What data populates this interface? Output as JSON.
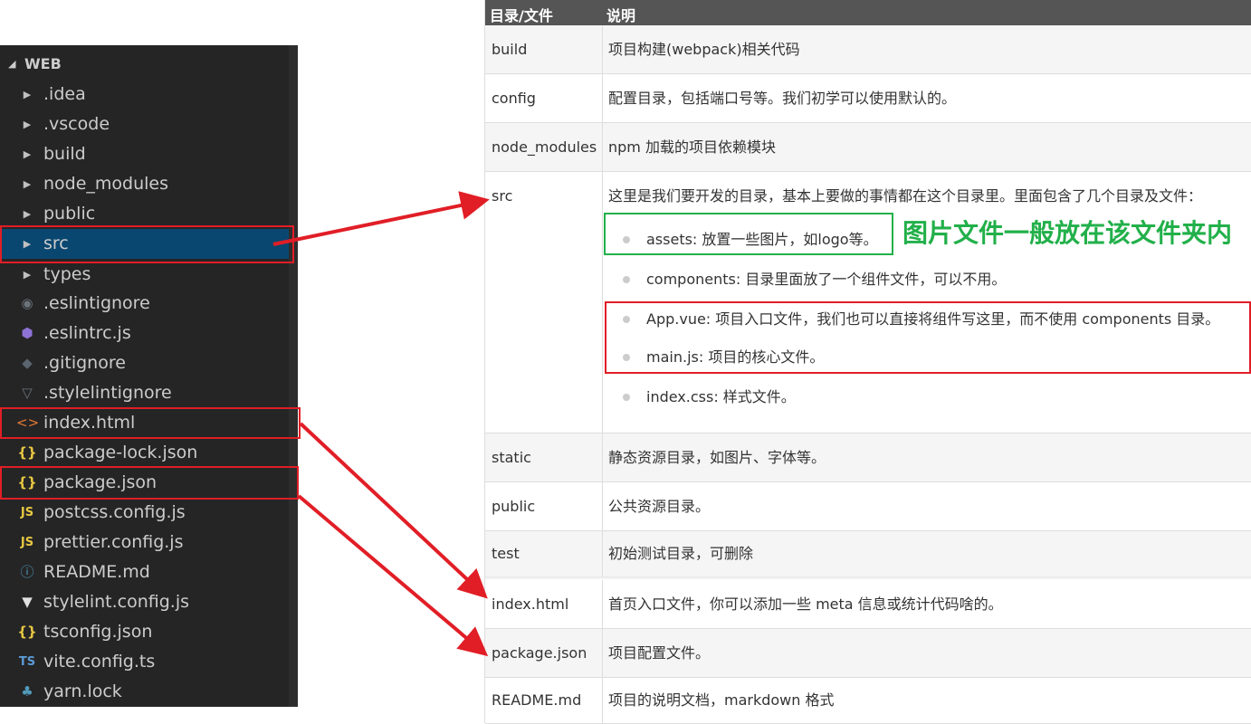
{
  "explorer": {
    "root_label": "WEB",
    "items": [
      {
        "label": ".idea",
        "kind": "folder",
        "icon": "chevron-right-icon"
      },
      {
        "label": ".vscode",
        "kind": "folder",
        "icon": "chevron-right-icon"
      },
      {
        "label": "build",
        "kind": "folder",
        "icon": "chevron-right-icon"
      },
      {
        "label": "node_modules",
        "kind": "folder",
        "icon": "chevron-right-icon"
      },
      {
        "label": "public",
        "kind": "folder",
        "icon": "chevron-right-icon"
      },
      {
        "label": "src",
        "kind": "folder",
        "icon": "chevron-right-icon",
        "selected": true
      },
      {
        "label": "types",
        "kind": "folder",
        "icon": "chevron-right-icon"
      },
      {
        "label": ".eslintignore",
        "kind": "file",
        "icon": "eslint-ignore-icon"
      },
      {
        "label": ".eslintrc.js",
        "kind": "file",
        "icon": "eslint-icon"
      },
      {
        "label": ".gitignore",
        "kind": "file",
        "icon": "git-icon"
      },
      {
        "label": ".stylelintignore",
        "kind": "file",
        "icon": "stylelint-ignore-icon"
      },
      {
        "label": "index.html",
        "kind": "file",
        "icon": "html-icon"
      },
      {
        "label": "package-lock.json",
        "kind": "file",
        "icon": "json-icon"
      },
      {
        "label": "package.json",
        "kind": "file",
        "icon": "json-icon"
      },
      {
        "label": "postcss.config.js",
        "kind": "file",
        "icon": "javascript-icon"
      },
      {
        "label": "prettier.config.js",
        "kind": "file",
        "icon": "javascript-icon"
      },
      {
        "label": "README.md",
        "kind": "file",
        "icon": "info-icon"
      },
      {
        "label": "stylelint.config.js",
        "kind": "file",
        "icon": "stylelint-icon"
      },
      {
        "label": "tsconfig.json",
        "kind": "file",
        "icon": "json-icon"
      },
      {
        "label": "vite.config.ts",
        "kind": "file",
        "icon": "typescript-icon"
      },
      {
        "label": "yarn.lock",
        "kind": "file",
        "icon": "yarn-icon"
      }
    ],
    "icon_glyphs": {
      "chevron": "▶",
      "json": "{}",
      "javascript": "JS",
      "typescript": "TS",
      "html": "<>"
    }
  },
  "table": {
    "header": {
      "col1": "目录/文件",
      "col2": "说明"
    },
    "rows": [
      {
        "name": "build",
        "desc": "项目构建(webpack)相关代码"
      },
      {
        "name": "config",
        "desc": "配置目录，包括端口号等。我们初学可以使用默认的。"
      },
      {
        "name": "node_modules",
        "desc": "npm 加载的项目依赖模块"
      },
      {
        "name": "src",
        "desc": "这里是我们要开发的目录，基本上要做的事情都在这个目录里。里面包含了几个目录及文件："
      },
      {
        "name": "static",
        "desc": "静态资源目录，如图片、字体等。"
      },
      {
        "name": "public",
        "desc": "公共资源目录。"
      },
      {
        "name": "test",
        "desc": "初始测试目录，可删除"
      },
      {
        "name": "index.html",
        "desc": "首页入口文件，你可以添加一些 meta 信息或统计代码啥的。"
      },
      {
        "name": "package.json",
        "desc": "项目配置文件。"
      },
      {
        "name": "README.md",
        "desc": "项目的说明文档，markdown 格式"
      }
    ],
    "src_items": [
      "assets: 放置一些图片，如logo等。",
      "components: 目录里面放了一个组件文件，可以不用。",
      "App.vue: 项目入口文件，我们也可以直接将组件写这里，而不使用 components 目录。",
      "main.js: 项目的核心文件。",
      "index.css: 样式文件。"
    ]
  },
  "annotation": {
    "note": "图片文件一般放在该文件夹内",
    "colors": {
      "red": "#e11e26",
      "green": "#22b04a"
    }
  }
}
